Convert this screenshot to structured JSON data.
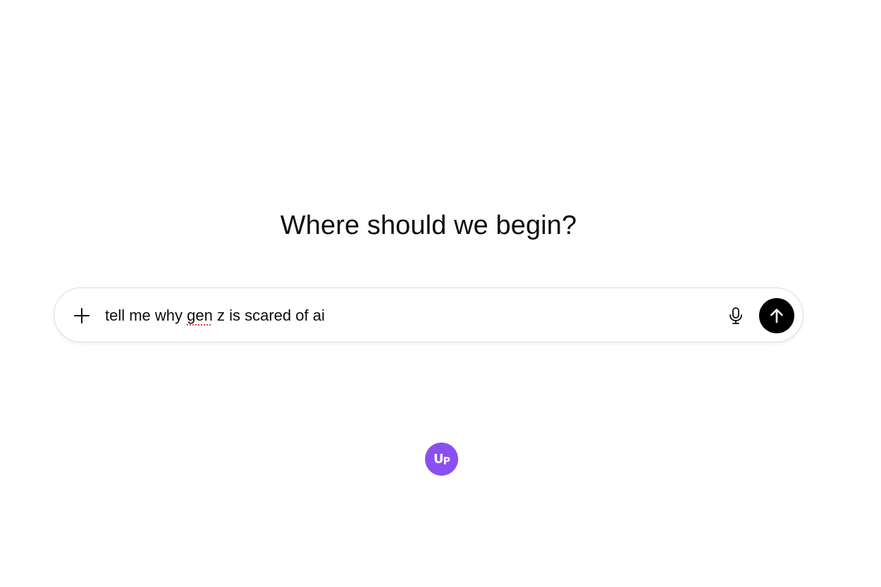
{
  "main": {
    "heading": "Where should we begin?"
  },
  "composer": {
    "prompt_before": "tell me why ",
    "prompt_misspelled": "gen",
    "prompt_after": " z is scared of ai",
    "add_icon": "plus-icon",
    "mic_icon": "microphone-icon",
    "send_icon": "arrow-up-icon"
  },
  "badge": {
    "letter_1": "U",
    "letter_2": "P",
    "color": "#8a4ff0"
  },
  "colors": {
    "send_button": "#000000",
    "spellcheck_underline": "#e0403f"
  }
}
